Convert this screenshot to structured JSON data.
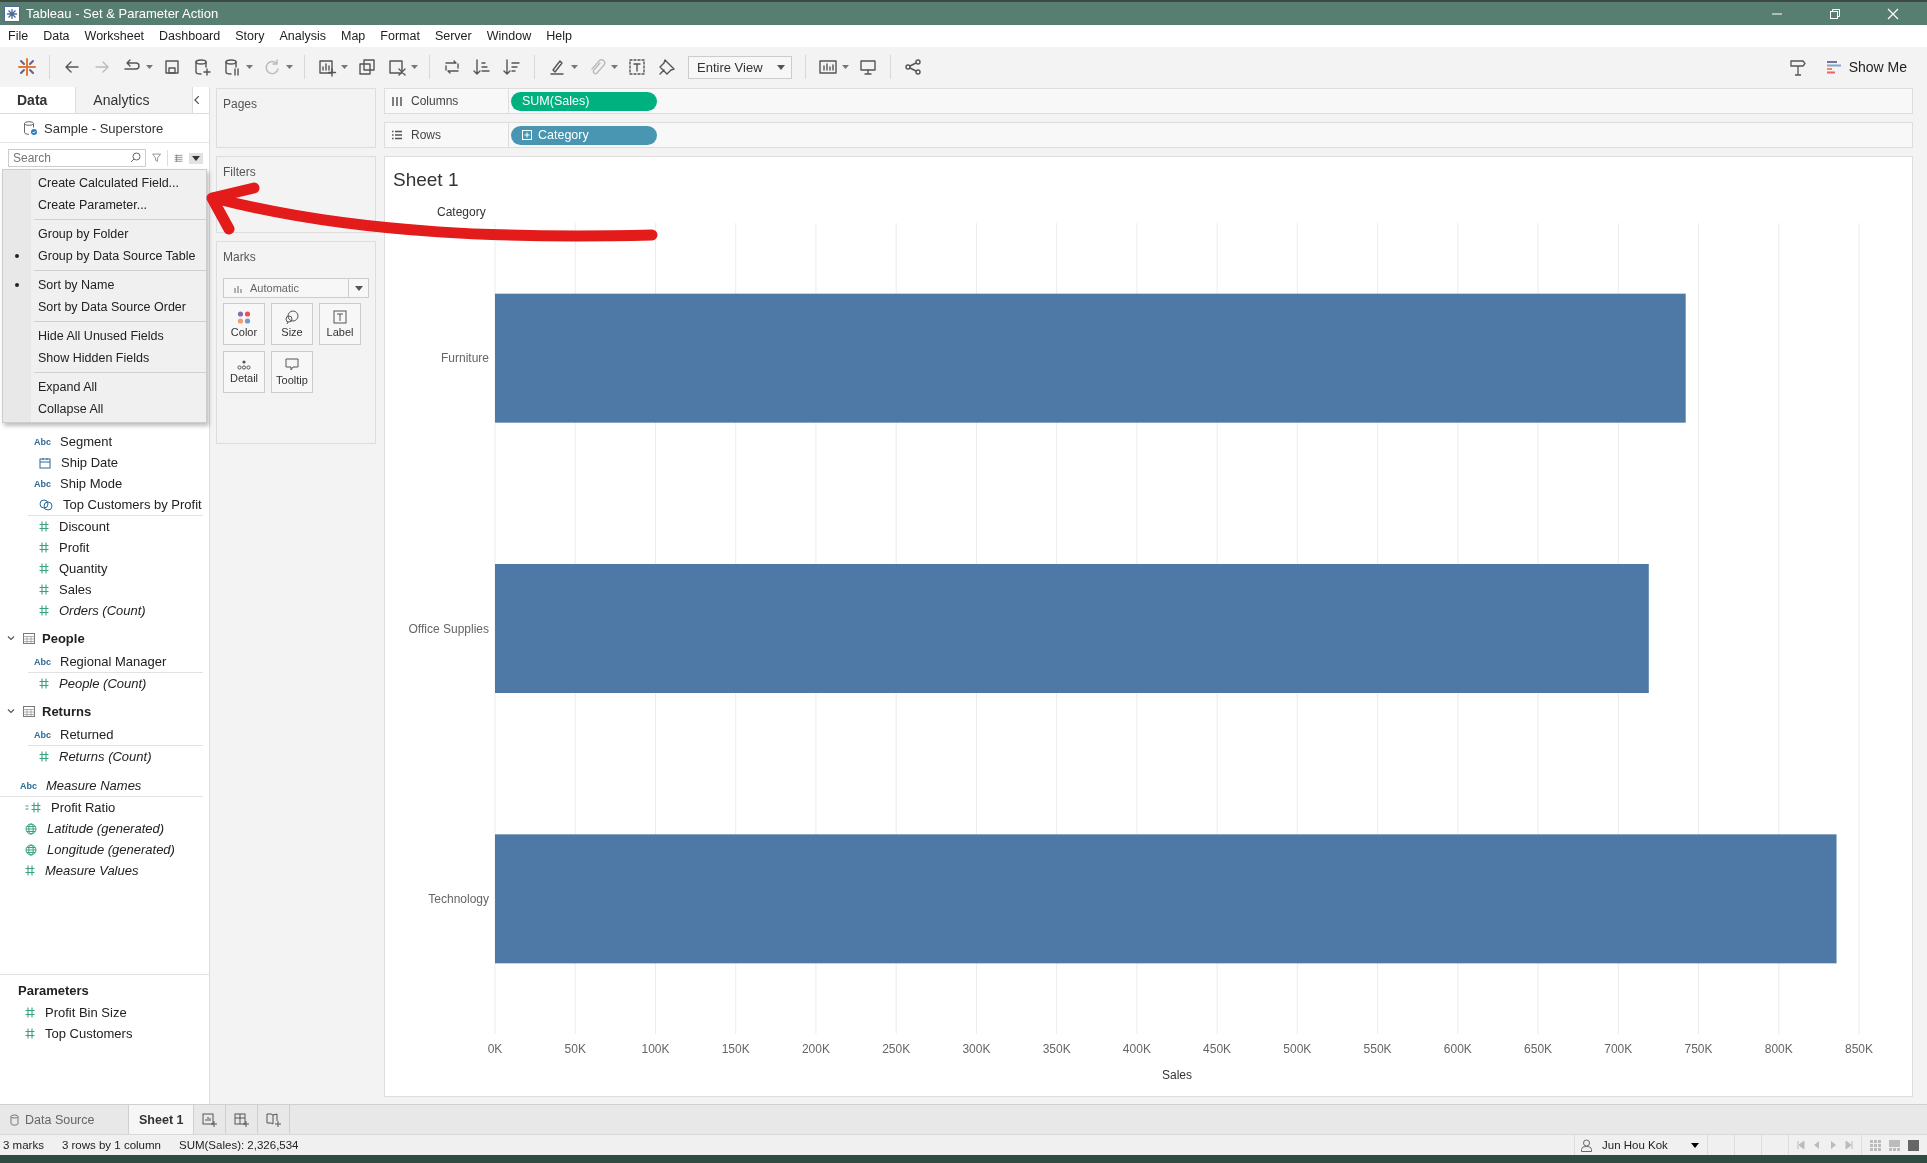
{
  "window": {
    "title": "Tableau - Set & Parameter Action"
  },
  "menu_bar": [
    "File",
    "Data",
    "Worksheet",
    "Dashboard",
    "Story",
    "Analysis",
    "Map",
    "Format",
    "Server",
    "Window",
    "Help"
  ],
  "toolbar": {
    "fit": "Entire View",
    "show_me": "Show Me"
  },
  "side_tabs": [
    {
      "label": "Data",
      "selected": true
    },
    {
      "label": "Analytics",
      "selected": false
    }
  ],
  "data_source": "Sample - Superstore",
  "search": {
    "placeholder": "Search"
  },
  "context_menu": {
    "sections": [
      [
        {
          "label": "Create Calculated Field...",
          "checked": false
        },
        {
          "label": "Create Parameter...",
          "checked": false
        }
      ],
      [
        {
          "label": "Group by Folder",
          "checked": false
        },
        {
          "label": "Group by Data Source Table",
          "checked": true
        }
      ],
      [
        {
          "label": "Sort by Name",
          "checked": true
        },
        {
          "label": "Sort by Data Source Order",
          "checked": false
        }
      ],
      [
        {
          "label": "Hide All Unused Fields",
          "checked": false
        },
        {
          "label": "Show Hidden Fields",
          "checked": false
        }
      ],
      [
        {
          "label": "Expand All",
          "checked": false
        },
        {
          "label": "Collapse All",
          "checked": false
        }
      ]
    ]
  },
  "field_groups": [
    {
      "children": [
        {
          "name": "Segment",
          "kind": "abc",
          "icon_text": "Abc",
          "generated": false,
          "divider_below": false
        },
        {
          "name": "Ship Date",
          "kind": "date",
          "generated": false,
          "divider_below": false
        },
        {
          "name": "Ship Mode",
          "kind": "abc",
          "icon_text": "Abc",
          "generated": false,
          "divider_below": false
        },
        {
          "name": "Top Customers by Profit",
          "kind": "set",
          "generated": false,
          "divider_below": true
        },
        {
          "name": "Discount",
          "kind": "number",
          "generated": false,
          "divider_below": false
        },
        {
          "name": "Profit",
          "kind": "number",
          "generated": false,
          "divider_below": false
        },
        {
          "name": "Quantity",
          "kind": "number",
          "generated": false,
          "divider_below": false
        },
        {
          "name": "Sales",
          "kind": "number",
          "generated": false,
          "divider_below": false
        },
        {
          "name": "Orders (Count)",
          "kind": "number",
          "generated": true,
          "divider_below": false
        }
      ]
    },
    {
      "name": "People",
      "expanded": true,
      "children": [
        {
          "name": "Regional Manager",
          "kind": "abc",
          "icon_text": "Abc",
          "generated": false,
          "divider_below": true
        },
        {
          "name": "People (Count)",
          "kind": "number",
          "generated": true,
          "divider_below": false
        }
      ]
    },
    {
      "name": "Returns",
      "expanded": true,
      "children": [
        {
          "name": "Returned",
          "kind": "abc",
          "icon_text": "Abc",
          "generated": false,
          "divider_below": true
        },
        {
          "name": "Returns (Count)",
          "kind": "number",
          "generated": true,
          "divider_below": false
        }
      ]
    }
  ],
  "loose_fields": [
    {
      "name": "Measure Names",
      "kind": "abc",
      "icon_text": "Abc",
      "generated": true,
      "divider_below": true
    },
    {
      "name": "Profit Ratio",
      "kind": "calc",
      "generated": false,
      "divider_below": false
    },
    {
      "name": "Latitude (generated)",
      "kind": "geo",
      "generated": true,
      "divider_below": false
    },
    {
      "name": "Longitude (generated)",
      "kind": "geo",
      "generated": true,
      "divider_below": false
    },
    {
      "name": "Measure Values",
      "kind": "number",
      "generated": true,
      "divider_below": false
    }
  ],
  "parameters": {
    "title": "Parameters",
    "items": [
      {
        "name": "Profit Bin Size",
        "kind": "number"
      },
      {
        "name": "Top Customers",
        "kind": "number"
      }
    ]
  },
  "pages_card": {
    "title": "Pages"
  },
  "filters_card": {
    "title": "Filters"
  },
  "marks_card": {
    "title": "Marks",
    "mark_type": "Automatic",
    "buttons": [
      {
        "label": "Color",
        "kind": "color"
      },
      {
        "label": "Size",
        "kind": "size"
      },
      {
        "label": "Label",
        "kind": "label"
      },
      {
        "label": "Detail",
        "kind": "detail"
      },
      {
        "label": "Tooltip",
        "kind": "tooltip"
      }
    ]
  },
  "shelves": [
    {
      "label": "Columns",
      "kind": "columns",
      "pills": [
        {
          "label": "SUM(Sales)",
          "kind": "measure",
          "expandable": false
        }
      ]
    },
    {
      "label": "Rows",
      "kind": "rows",
      "pills": [
        {
          "label": "Category",
          "kind": "dimension",
          "expandable": true
        }
      ]
    }
  ],
  "sheet": {
    "title": "Sheet 1",
    "chart_data": {
      "type": "bar",
      "orientation": "horizontal",
      "grid": true,
      "xlabel": "Sales",
      "ylabel": "Category",
      "categories": [
        "Furniture",
        "Office Supplies",
        "Technology"
      ],
      "series": [
        {
          "color": "#4e79a7",
          "values": [
            742000,
            719000,
            836000
          ]
        }
      ],
      "xlim": [
        0,
        850000
      ],
      "xticks": [
        {
          "value": 0,
          "label": "0K"
        },
        {
          "value": 50000,
          "label": "50K"
        },
        {
          "value": 100000,
          "label": "100K"
        },
        {
          "value": 150000,
          "label": "150K"
        },
        {
          "value": 200000,
          "label": "200K"
        },
        {
          "value": 250000,
          "label": "250K"
        },
        {
          "value": 300000,
          "label": "300K"
        },
        {
          "value": 350000,
          "label": "350K"
        },
        {
          "value": 400000,
          "label": "400K"
        },
        {
          "value": 450000,
          "label": "450K"
        },
        {
          "value": 500000,
          "label": "500K"
        },
        {
          "value": 550000,
          "label": "550K"
        },
        {
          "value": 600000,
          "label": "600K"
        },
        {
          "value": 650000,
          "label": "650K"
        },
        {
          "value": 700000,
          "label": "700K"
        },
        {
          "value": 750000,
          "label": "750K"
        },
        {
          "value": 800000,
          "label": "800K"
        },
        {
          "value": 850000,
          "label": "850K"
        }
      ]
    }
  },
  "sheet_tabs": [
    {
      "label": "Data Source",
      "kind": "data-source",
      "selected": false
    },
    {
      "label": "Sheet 1",
      "kind": "sheet",
      "selected": true
    }
  ],
  "status_bar": {
    "marks": "3 marks",
    "shape": "3 rows by 1 column",
    "sum": "SUM(Sales): 2,326,534",
    "user": "Jun Hou Kok"
  }
}
